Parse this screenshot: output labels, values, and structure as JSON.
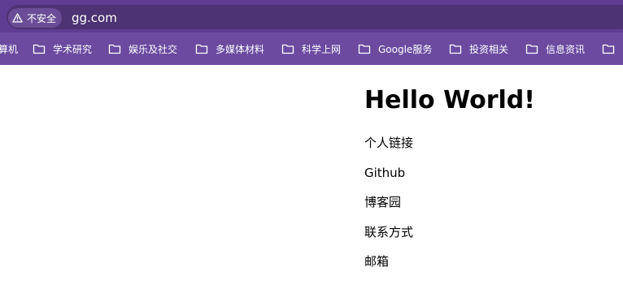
{
  "browser": {
    "security_label": "不安全",
    "url": "gg.com"
  },
  "bookmarks": [
    "算机",
    "学术研究",
    "娱乐及社交",
    "多媒体材料",
    "科学上网",
    "Google服务",
    "投资相关",
    "信息资讯"
  ],
  "page": {
    "title": "Hello World!",
    "links": [
      "个人链接",
      "Github",
      "博客园",
      "联系方式",
      "邮箱"
    ]
  },
  "colors": {
    "title_bar": "#5f3d93",
    "omnibox": "#4d3274",
    "bookmark_bar": "#6b4aa0"
  }
}
